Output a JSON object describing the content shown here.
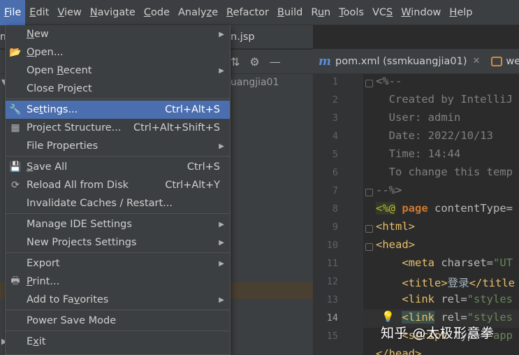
{
  "menubar": {
    "items": [
      {
        "label": "File",
        "mn": "F",
        "rest": "ile",
        "active": true
      },
      {
        "label": "Edit",
        "mn": "E",
        "rest": "dit"
      },
      {
        "label": "View",
        "mn": "V",
        "rest": "iew"
      },
      {
        "label": "Navigate",
        "mn": "N",
        "rest": "avigate"
      },
      {
        "label": "Code",
        "mn": "C",
        "rest": "ode"
      },
      {
        "label": "Analyze",
        "mn": "z",
        "pre": "Analy",
        "rest": "e"
      },
      {
        "label": "Refactor",
        "mn": "R",
        "rest": "efactor"
      },
      {
        "label": "Build",
        "mn": "B",
        "rest": "uild"
      },
      {
        "label": "Run",
        "mn": "u",
        "pre": "R",
        "rest": "n"
      },
      {
        "label": "Tools",
        "mn": "T",
        "rest": "ools"
      },
      {
        "label": "VCS",
        "mn": "S",
        "pre": "VC",
        "rest": ""
      },
      {
        "label": "Window",
        "mn": "W",
        "rest": "indow"
      },
      {
        "label": "Help",
        "mn": "H",
        "rest": "elp"
      }
    ]
  },
  "background": {
    "file_tab_fragment": "n.jsp",
    "m_fragment": "m",
    "project_root_fragment": "uangjia01"
  },
  "editor_tabs": [
    {
      "icon": "maven-icon",
      "label": "pom.xml (ssmkuangjia01)"
    },
    {
      "icon": "web-icon",
      "label": "web"
    }
  ],
  "editor": {
    "line_numbers": [
      "1",
      "2",
      "3",
      "4",
      "5",
      "6",
      "7",
      "8",
      "9",
      "10",
      "11",
      "12",
      "13",
      "14",
      "15"
    ],
    "current_line": "14",
    "lines": [
      {
        "parts": [
          {
            "c": "c-comment",
            "t": "<%--"
          }
        ]
      },
      {
        "parts": [
          {
            "c": "c-comment",
            "t": "  Created by IntelliJ"
          }
        ]
      },
      {
        "parts": [
          {
            "c": "c-comment",
            "t": "  User: admin"
          }
        ]
      },
      {
        "parts": [
          {
            "c": "c-comment",
            "t": "  Date: 2022/10/13"
          }
        ]
      },
      {
        "parts": [
          {
            "c": "c-comment",
            "t": "  Time: 14:44"
          }
        ]
      },
      {
        "parts": [
          {
            "c": "c-comment",
            "t": "  To change this temp"
          }
        ]
      },
      {
        "parts": [
          {
            "c": "c-comment",
            "t": "--%>"
          }
        ]
      },
      {
        "parts": [
          {
            "c": "c-dir",
            "t": "<%@"
          },
          {
            "c": "c-text",
            "t": " "
          },
          {
            "c": "c-kw",
            "t": "page"
          },
          {
            "c": "c-attr",
            "t": " contentType="
          }
        ]
      },
      {
        "parts": [
          {
            "c": "c-tag",
            "t": "<html>"
          }
        ]
      },
      {
        "parts": [
          {
            "c": "c-tag",
            "t": "<head>"
          }
        ]
      },
      {
        "parts": [
          {
            "c": "c-text",
            "t": "    "
          },
          {
            "c": "c-tag",
            "t": "<meta"
          },
          {
            "c": "c-attr",
            "t": " charset="
          },
          {
            "c": "c-str",
            "t": "\"UT"
          }
        ]
      },
      {
        "parts": [
          {
            "c": "c-text",
            "t": "    "
          },
          {
            "c": "c-tag",
            "t": "<title>"
          },
          {
            "c": "c-text",
            "t": "登录"
          },
          {
            "c": "c-tag",
            "t": "</title"
          }
        ]
      },
      {
        "parts": [
          {
            "c": "c-text",
            "t": "    "
          },
          {
            "c": "c-tag",
            "t": "<link"
          },
          {
            "c": "c-attr",
            "t": " rel="
          },
          {
            "c": "c-str",
            "t": "\"styles"
          }
        ]
      },
      {
        "parts": [
          {
            "c": "c-text",
            "t": "    "
          },
          {
            "c": "c-tag c-sel",
            "t": "<link"
          },
          {
            "c": "c-attr",
            "t": " rel="
          },
          {
            "c": "c-str",
            "t": "\"styles"
          }
        ]
      },
      {
        "parts": [
          {
            "c": "c-text",
            "t": "    "
          },
          {
            "c": "c-tag",
            "t": "<script"
          },
          {
            "c": "c-attr",
            "t": " type="
          },
          {
            "c": "c-str",
            "t": "\"app"
          }
        ]
      },
      {
        "parts": [
          {
            "c": "c-tag",
            "t": "</head>"
          }
        ]
      }
    ]
  },
  "watermark": "知乎 @太极形意拳",
  "file_menu": {
    "items": [
      {
        "type": "item",
        "pre": "",
        "mn": "N",
        "rest": "ew",
        "submenu": true,
        "icon": ""
      },
      {
        "type": "item",
        "pre": "",
        "mn": "O",
        "rest": "pen...",
        "icon": "folder-open-icon",
        "glyph": "📂"
      },
      {
        "type": "item",
        "pre": "Open ",
        "mn": "R",
        "rest": "ecent",
        "submenu": true,
        "icon": ""
      },
      {
        "type": "item",
        "pre": "Close Pro",
        "mn": "j",
        "rest": "ect",
        "icon": ""
      },
      {
        "type": "sep"
      },
      {
        "type": "item",
        "pre": "Se",
        "mn": "t",
        "rest": "tings...",
        "shortcut": "Ctrl+Alt+S",
        "icon": "wrench-icon",
        "glyph": "🔧",
        "selected": true
      },
      {
        "type": "item",
        "pre": "Project Structure...",
        "mn": "",
        "rest": "",
        "shortcut": "Ctrl+Alt+Shift+S",
        "icon": "project-structure-icon",
        "glyph": "▦"
      },
      {
        "type": "item",
        "pre": "File Properties",
        "mn": "",
        "rest": "",
        "submenu": true,
        "icon": ""
      },
      {
        "type": "sep"
      },
      {
        "type": "item",
        "pre": "",
        "mn": "S",
        "rest": "ave All",
        "shortcut": "Ctrl+S",
        "icon": "save-icon",
        "glyph": "💾"
      },
      {
        "type": "item",
        "pre": "Reload All from Disk",
        "mn": "",
        "rest": "",
        "shortcut": "Ctrl+Alt+Y",
        "icon": "reload-icon",
        "glyph": "⟳"
      },
      {
        "type": "item",
        "pre": "Invalidate Caches / Restart...",
        "mn": "",
        "rest": "",
        "icon": ""
      },
      {
        "type": "sep"
      },
      {
        "type": "item",
        "pre": "Manage IDE Settings",
        "mn": "",
        "rest": "",
        "submenu": true,
        "icon": ""
      },
      {
        "type": "item",
        "pre": "New Projects Settings",
        "mn": "",
        "rest": "",
        "submenu": true,
        "icon": ""
      },
      {
        "type": "sep"
      },
      {
        "type": "item",
        "pre": "Export",
        "mn": "",
        "rest": "",
        "submenu": true,
        "icon": ""
      },
      {
        "type": "item",
        "pre": "",
        "mn": "P",
        "rest": "rint...",
        "icon": "print-icon",
        "glyph": "🖶"
      },
      {
        "type": "item",
        "pre": "Add to Fa",
        "mn": "v",
        "rest": "orites",
        "submenu": true,
        "icon": ""
      },
      {
        "type": "sep"
      },
      {
        "type": "item",
        "pre": "Power Save Mode",
        "mn": "",
        "rest": "",
        "icon": ""
      },
      {
        "type": "sep"
      },
      {
        "type": "item",
        "pre": "E",
        "mn": "x",
        "rest": "it",
        "icon": ""
      }
    ]
  }
}
